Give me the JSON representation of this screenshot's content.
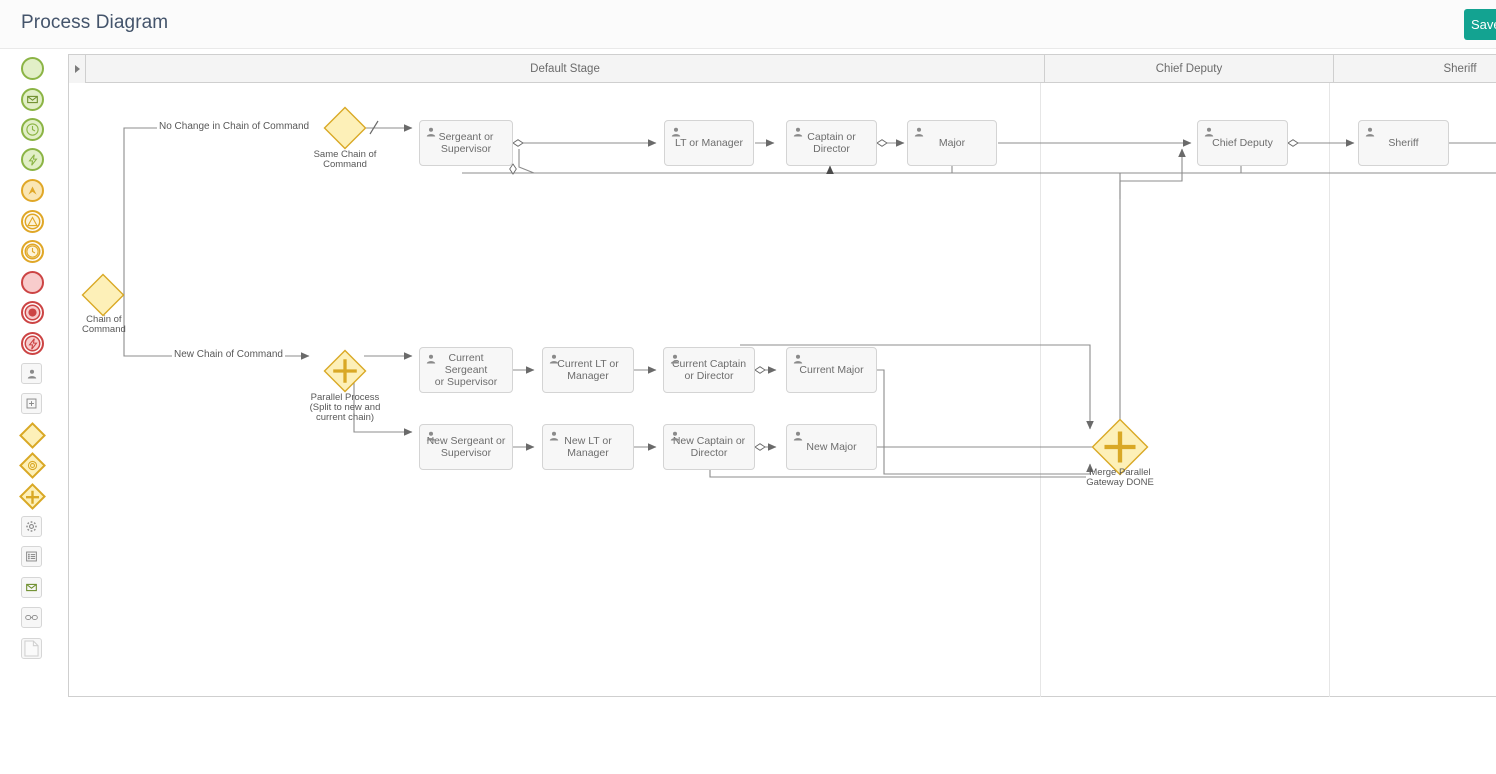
{
  "header": {
    "title": "Process Diagram",
    "save_label": "Save"
  },
  "palette": {
    "items": [
      {
        "name": "start-event",
        "kind": "circle",
        "stroke": "#8bb445",
        "fill": "#e2efc7",
        "glyph": ""
      },
      {
        "name": "start-message-event",
        "kind": "circle",
        "stroke": "#8bb445",
        "fill": "#e2efc7",
        "glyph": "envelope"
      },
      {
        "name": "start-timer-event",
        "kind": "circle",
        "stroke": "#8bb445",
        "fill": "#e2efc7",
        "glyph": "clock"
      },
      {
        "name": "start-signal-event",
        "kind": "circle",
        "stroke": "#8bb445",
        "fill": "#e2efc7",
        "glyph": "signal"
      },
      {
        "name": "intermediate-escalation-event",
        "kind": "circle",
        "stroke": "#e0a727",
        "fill": "#fae6b4",
        "glyph": "escalation"
      },
      {
        "name": "intermediate-signal-event",
        "kind": "circle",
        "stroke": "#e0a727",
        "fill": "#fdf3d8",
        "glyph": "triangle"
      },
      {
        "name": "intermediate-timer-event",
        "kind": "circle",
        "stroke": "#e0a727",
        "fill": "#fdf3d8",
        "glyph": "clock"
      },
      {
        "name": "end-event",
        "kind": "circle",
        "stroke": "#cc4444",
        "fill": "#f8cccc",
        "glyph": ""
      },
      {
        "name": "end-terminate-event",
        "kind": "circle",
        "stroke": "#cc4444",
        "fill": "#f8cccc",
        "glyph": "dot"
      },
      {
        "name": "end-signal-event",
        "kind": "circle",
        "stroke": "#cc4444",
        "fill": "#f8cccc",
        "glyph": "signal"
      },
      {
        "name": "user-task",
        "kind": "square",
        "glyph": "person"
      },
      {
        "name": "sub-process",
        "kind": "square",
        "glyph": "plus-box"
      },
      {
        "name": "exclusive-gateway",
        "kind": "diamond",
        "stroke": "#d9a825",
        "fill": "#fdf0b8",
        "glyph": ""
      },
      {
        "name": "event-gateway",
        "kind": "diamond",
        "stroke": "#d9a825",
        "fill": "#fdf0b8",
        "glyph": "circle-ring"
      },
      {
        "name": "parallel-gateway",
        "kind": "diamond",
        "stroke": "#d9a825",
        "fill": "#fdf0b8",
        "glyph": "plus"
      },
      {
        "name": "service-task",
        "kind": "square",
        "glyph": "gear"
      },
      {
        "name": "business-rule-task",
        "kind": "square",
        "glyph": "list"
      },
      {
        "name": "send-task",
        "kind": "square",
        "glyph": "envelope"
      },
      {
        "name": "script-task",
        "kind": "square",
        "glyph": "link"
      },
      {
        "name": "data-object",
        "kind": "square",
        "glyph": "page"
      }
    ]
  },
  "pool": {
    "lanes": [
      {
        "id": "default-stage",
        "label": "Default Stage"
      },
      {
        "id": "chief-deputy",
        "label": "Chief Deputy"
      },
      {
        "id": "sheriff",
        "label": "Sheriff"
      }
    ]
  },
  "diagram": {
    "gateways": [
      {
        "id": "chain-of-command",
        "label": "Chain of\nCommand",
        "type": "exclusive"
      },
      {
        "id": "same-chain-of-command",
        "label": "Same Chain of\nCommand",
        "type": "exclusive"
      },
      {
        "id": "parallel-process",
        "label": "Parallel Process\n(Split to new and\ncurrent chain)",
        "type": "parallel"
      },
      {
        "id": "merge-parallel-gateway-done",
        "label": "Merge Parallel\nGateway DONE",
        "type": "parallel"
      }
    ],
    "tasks": [
      {
        "id": "sergeant-or-supervisor",
        "label": "Sergeant or\nSupervisor"
      },
      {
        "id": "lt-or-manager",
        "label": "LT or Manager"
      },
      {
        "id": "captain-or-director",
        "label": "Captain or\nDirector"
      },
      {
        "id": "major",
        "label": "Major"
      },
      {
        "id": "chief-deputy",
        "label": "Chief Deputy"
      },
      {
        "id": "sheriff",
        "label": "Sheriff"
      },
      {
        "id": "current-sergeant-or-supervisor",
        "label": "Current Sergeant\nor Supervisor"
      },
      {
        "id": "current-lt-or-manager",
        "label": "Current LT or\nManager"
      },
      {
        "id": "current-captain-or-director",
        "label": "Current Captain\nor Director"
      },
      {
        "id": "current-major",
        "label": "Current Major"
      },
      {
        "id": "new-sergeant-or-supervisor",
        "label": "New Sergeant or\nSupervisor"
      },
      {
        "id": "new-lt-or-manager",
        "label": "New LT or\nManager"
      },
      {
        "id": "new-captain-or-director",
        "label": "New Captain or\nDirector"
      },
      {
        "id": "new-major",
        "label": "New Major"
      }
    ],
    "flow_labels": [
      {
        "id": "no-change-in-chain-of-command",
        "text": "No Change in Chain of Command"
      },
      {
        "id": "new-chain-of-command",
        "text": "New Chain of Command"
      }
    ]
  },
  "colors": {
    "accent": "#13a391",
    "gateway_fill": "#fdf0b8",
    "gateway_stroke": "#d9a825",
    "task_fill": "#f7f7f7",
    "task_stroke": "#d4d4d4",
    "connector": "#8c8c8c",
    "pool_stroke": "#cfcfcf"
  }
}
